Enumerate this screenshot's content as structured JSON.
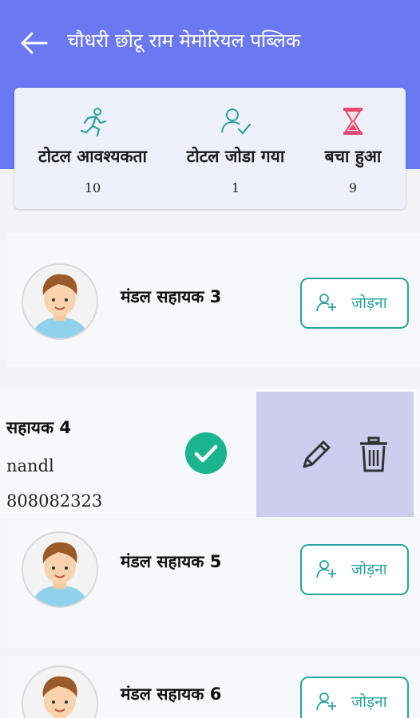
{
  "header": {
    "title": "चौधरी छोटू राम मेमोरियल पब्लिक",
    "back_icon": "arrow-left-icon"
  },
  "stats": [
    {
      "label": "टोटल आवश्यकता",
      "value": "10",
      "icon": "running-person-icon"
    },
    {
      "label": "टोटल जोडा गया",
      "value": "1",
      "icon": "user-check-icon"
    },
    {
      "label": "बचा हुआ",
      "value": "9",
      "icon": "hourglass-icon"
    }
  ],
  "cards": [
    {
      "name": "मंडल सहायक 3",
      "button": "जोड़ना"
    },
    {
      "name": "मंडल सहायक 5",
      "button": "जोड़ना"
    },
    {
      "name": "मंडल सहायक 6",
      "button": "जोड़ना"
    }
  ],
  "swiped_card": {
    "name": "सहायक 4",
    "line2": "nandl",
    "line3": "808082323"
  },
  "colors": {
    "header": "#6a78f2",
    "accent": "#2aa3a0",
    "success": "#1ab58e",
    "actions_bg": "#cdcdf0"
  }
}
